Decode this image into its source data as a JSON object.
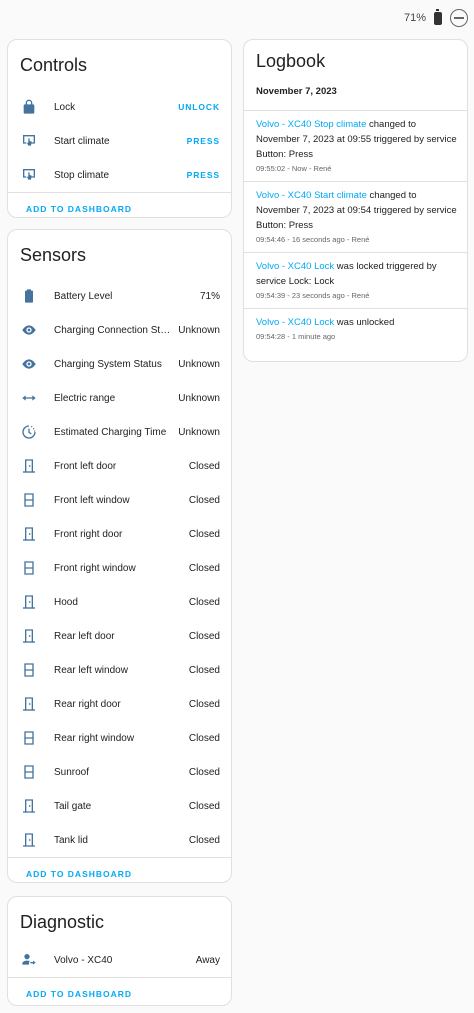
{
  "status_bar": {
    "battery": "71%",
    "battery_icon": "battery-icon",
    "avatar_icon": "volvo-logo-icon"
  },
  "controls": {
    "title": "Controls",
    "items": [
      {
        "icon": "lock-icon",
        "label": "Lock",
        "action": "UNLOCK"
      },
      {
        "icon": "remote-start-icon",
        "label": "Start climate",
        "action": "PRESS"
      },
      {
        "icon": "remote-start-icon",
        "label": "Stop climate",
        "action": "PRESS"
      }
    ],
    "footer": "ADD TO DASHBOARD"
  },
  "sensors": {
    "title": "Sensors",
    "items": [
      {
        "icon": "battery-icon",
        "label": "Battery Level",
        "value": "71%"
      },
      {
        "icon": "eye-icon",
        "label": "Charging Connection Stat...",
        "value": "Unknown"
      },
      {
        "icon": "eye-icon",
        "label": "Charging System Status",
        "value": "Unknown"
      },
      {
        "icon": "arrow-left-right-icon",
        "label": "Electric range",
        "value": "Unknown"
      },
      {
        "icon": "timer-icon",
        "label": "Estimated Charging Time",
        "value": "Unknown"
      },
      {
        "icon": "door-icon",
        "label": "Front left door",
        "value": "Closed"
      },
      {
        "icon": "window-icon",
        "label": "Front left window",
        "value": "Closed"
      },
      {
        "icon": "door-icon",
        "label": "Front right door",
        "value": "Closed"
      },
      {
        "icon": "window-icon",
        "label": "Front right window",
        "value": "Closed"
      },
      {
        "icon": "door-icon",
        "label": "Hood",
        "value": "Closed"
      },
      {
        "icon": "door-icon",
        "label": "Rear left door",
        "value": "Closed"
      },
      {
        "icon": "window-icon",
        "label": "Rear left window",
        "value": "Closed"
      },
      {
        "icon": "door-icon",
        "label": "Rear right door",
        "value": "Closed"
      },
      {
        "icon": "window-icon",
        "label": "Rear right window",
        "value": "Closed"
      },
      {
        "icon": "window-icon",
        "label": "Sunroof",
        "value": "Closed"
      },
      {
        "icon": "door-icon",
        "label": "Tail gate",
        "value": "Closed"
      },
      {
        "icon": "door-icon",
        "label": "Tank lid",
        "value": "Closed"
      }
    ],
    "footer": "ADD TO DASHBOARD"
  },
  "diagnostic": {
    "title": "Diagnostic",
    "items": [
      {
        "icon": "account-arrow-icon",
        "label": "Volvo - XC40",
        "value": "Away"
      }
    ],
    "footer": "ADD TO DASHBOARD"
  },
  "logbook": {
    "title": "Logbook",
    "date": "November 7, 2023",
    "entries": [
      {
        "entity": "Volvo - XC40 Stop climate",
        "message": " changed to November 7, 2023 at 09:55 triggered by service Button: Press",
        "meta": "09:55:02 - Now - René"
      },
      {
        "entity": "Volvo - XC40 Start climate",
        "message": " changed to November 7, 2023 at 09:54 triggered by service Button: Press",
        "meta": "09:54:46 - 16 seconds ago - René"
      },
      {
        "entity": "Volvo - XC40 Lock",
        "message": " was locked triggered by service Lock: Lock",
        "meta": "09:54:39 - 23 seconds ago - René"
      },
      {
        "entity": "Volvo - XC40 Lock",
        "message": " was unlocked",
        "meta": "09:54:28 - 1 minute ago"
      }
    ]
  }
}
